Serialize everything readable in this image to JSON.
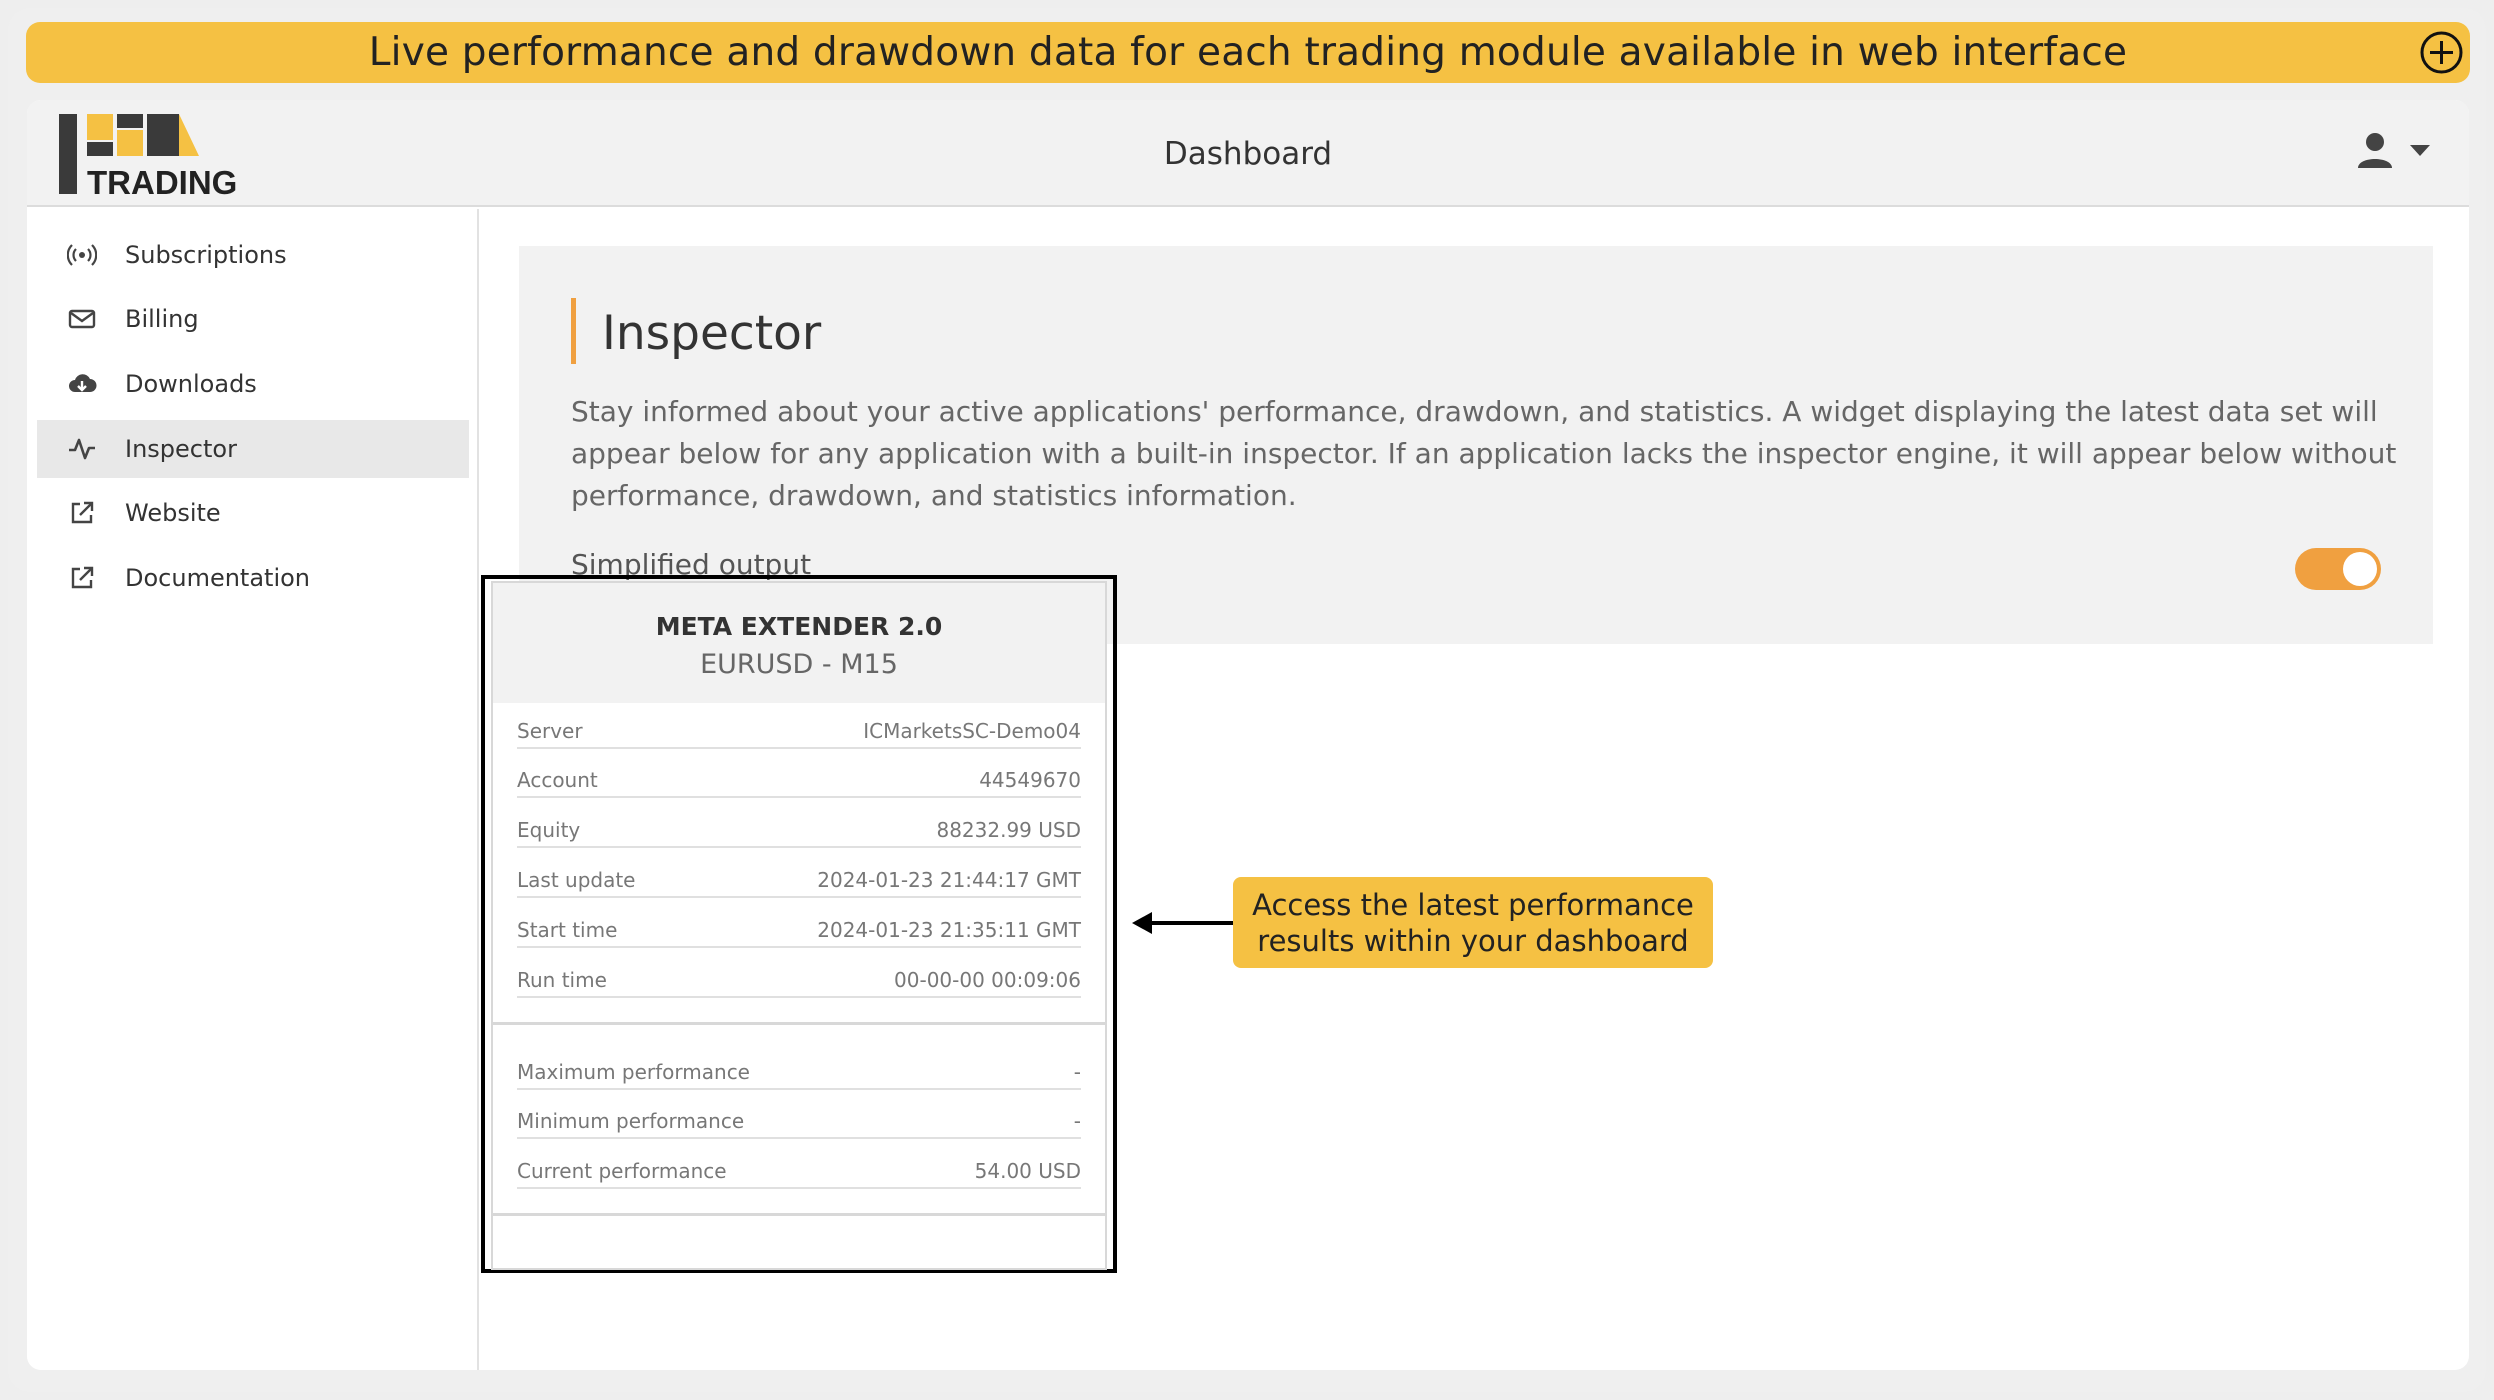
{
  "banner": {
    "text": "Live performance and drawdown data for each trading module available in web interface",
    "expand_icon": "plus-circle-icon"
  },
  "header": {
    "logo_text": "TRADING",
    "title": "Dashboard",
    "user_icon": "user-icon",
    "menu_icon": "caret-down-icon"
  },
  "sidebar": {
    "items": [
      {
        "label": "Subscriptions",
        "icon": "broadcast-icon",
        "active": false
      },
      {
        "label": "Billing",
        "icon": "envelope-icon",
        "active": false
      },
      {
        "label": "Downloads",
        "icon": "cloud-download-icon",
        "active": false
      },
      {
        "label": "Inspector",
        "icon": "activity-icon",
        "active": true
      },
      {
        "label": "Website",
        "icon": "external-link-icon",
        "active": false
      },
      {
        "label": "Documentation",
        "icon": "external-link-icon",
        "active": false
      }
    ]
  },
  "inspector": {
    "title": "Inspector",
    "description": "Stay informed about your active applications' performance, drawdown, and statistics. A widget displaying the latest data set will appear below for any application with a built-in inspector. If an application lacks the inspector engine, it will appear below without performance, drawdown, and statistics information.",
    "toggle_label": "Simplified output",
    "toggle_on": true
  },
  "widget": {
    "title": "META EXTENDER 2.0",
    "subtitle": "EURUSD - M15",
    "info_rows": [
      {
        "label": "Server",
        "value": "ICMarketsSC-Demo04"
      },
      {
        "label": "Account",
        "value": "44549670"
      },
      {
        "label": "Equity",
        "value": "88232.99 USD"
      },
      {
        "label": "Last update",
        "value": "2024-01-23 21:44:17 GMT"
      },
      {
        "label": "Start time",
        "value": "2024-01-23 21:35:11 GMT"
      },
      {
        "label": "Run time",
        "value": "00-00-00 00:09:06"
      }
    ],
    "performance_rows": [
      {
        "label": "Maximum performance",
        "value": "-"
      },
      {
        "label": "Minimum performance",
        "value": "-"
      },
      {
        "label": "Current performance",
        "value": "54.00 USD"
      }
    ]
  },
  "callout": {
    "line1": "Access the latest performance",
    "line2": "results within your dashboard"
  },
  "colors": {
    "banner": "#f5c143",
    "accent": "#f0a040",
    "logo_dark": "#3a3a3a"
  }
}
